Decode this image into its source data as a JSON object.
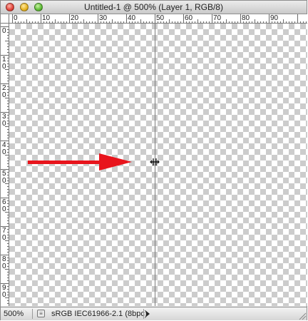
{
  "window": {
    "title": "Untitled-1 @ 500% (Layer 1, RGB/8)",
    "traffic_lights": [
      "close-button",
      "minimize-button",
      "zoom-button"
    ]
  },
  "horizontal_ruler": {
    "labels": [
      "0",
      "10",
      "20",
      "30",
      "40",
      "50",
      "60",
      "70",
      "80",
      "90"
    ]
  },
  "vertical_ruler": {
    "labels": [
      "0",
      "1\n0",
      "2\n0",
      "3\n0",
      "4\n0",
      "5\n0",
      "6\n0",
      "7\n0",
      "8\n0",
      "9\n0"
    ]
  },
  "canvas": {
    "background": "transparency-checkerboard",
    "annotation": "red-arrow",
    "cursor": "move-guide-cursor"
  },
  "status_bar": {
    "zoom": "500%",
    "profile": "sRGB IEC61966-2.1 (8bpc)"
  },
  "colors": {
    "arrow": "#e8141c",
    "guide": "#7d7d7d",
    "checker_dark": "#cccccc",
    "checker_light": "#ffffff"
  }
}
